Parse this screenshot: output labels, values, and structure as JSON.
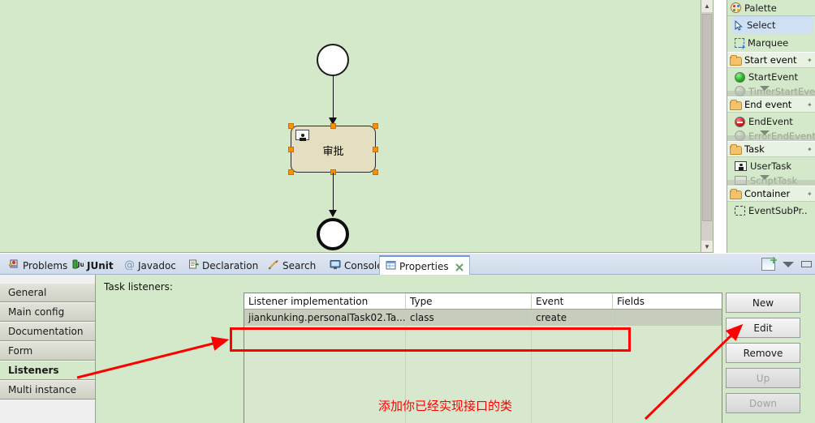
{
  "canvas": {
    "background_color": "#d4e8ca",
    "nodes": [
      {
        "name": "start-event",
        "label": "",
        "shape": "circle-thin"
      },
      {
        "name": "user-task",
        "label": "审批",
        "shape": "rounded-rect",
        "selected": true,
        "fill": "#e3dfc0"
      },
      {
        "name": "end-event",
        "label": "",
        "shape": "circle-thick"
      }
    ],
    "scrollbar": {
      "up_arrow": "^",
      "down_arrow": "v"
    }
  },
  "palette": {
    "title": "Palette",
    "title_icon": "palette-icon",
    "tools": [
      {
        "label": "Select",
        "icon": "cursor-icon",
        "selected": true
      },
      {
        "label": "Marquee",
        "icon": "marquee-icon",
        "selected": false
      }
    ],
    "groups": [
      {
        "label": "Start event",
        "items": [
          {
            "label": "StartEvent",
            "icon": "start-event-icon"
          }
        ],
        "clipped_item": {
          "label": "TimerStartEvent",
          "icon": "grey-disc-icon"
        }
      },
      {
        "label": "End event",
        "items": [
          {
            "label": "EndEvent",
            "icon": "end-event-icon"
          }
        ],
        "clipped_item": {
          "label": "ErrorEndEvent",
          "icon": "grey-disc-icon"
        }
      },
      {
        "label": "Task",
        "items": [
          {
            "label": "UserTask",
            "icon": "user-task-icon"
          }
        ],
        "clipped_item": {
          "label": "ScriptTask",
          "icon": "grey-rect-icon"
        }
      },
      {
        "label": "Container",
        "items": [
          {
            "label": "EventSubPr..",
            "icon": "event-subprocess-icon"
          }
        ],
        "clipped_item": null
      }
    ]
  },
  "view_tabs": {
    "tabs": [
      {
        "label": "Problems",
        "icon": "problems-icon",
        "active": false,
        "bold": false
      },
      {
        "label": "JUnit",
        "icon": "junit-icon",
        "active": false,
        "bold": true
      },
      {
        "label": "Javadoc",
        "icon": "javadoc-icon",
        "active": false,
        "bold": false
      },
      {
        "label": "Declaration",
        "icon": "declaration-icon",
        "active": false,
        "bold": false
      },
      {
        "label": "Search",
        "icon": "search-icon",
        "active": false,
        "bold": false
      },
      {
        "label": "Console",
        "icon": "console-icon",
        "active": false,
        "bold": false
      },
      {
        "label": "Properties",
        "icon": "properties-icon",
        "active": true,
        "bold": false,
        "closable": true
      }
    ],
    "toolbar": [
      {
        "name": "new-view-icon"
      },
      {
        "name": "view-menu-chevron-icon"
      },
      {
        "name": "minimize-icon"
      }
    ]
  },
  "properties": {
    "tabs": [
      {
        "label": "General",
        "active": false
      },
      {
        "label": "Main config",
        "active": false
      },
      {
        "label": "Documentation",
        "active": false
      },
      {
        "label": "Form",
        "active": false
      },
      {
        "label": "Listeners",
        "active": true
      },
      {
        "label": "Multi instance",
        "active": false
      }
    ],
    "section_label": "Task listeners:",
    "table": {
      "columns": [
        "Listener implementation",
        "Type",
        "Event",
        "Fields"
      ],
      "rows": [
        {
          "implementation": "jiankunking.personalTask02.Ta...",
          "type": "class",
          "event": "create",
          "fields": "",
          "selected": true
        }
      ],
      "empty_row_count": 6
    },
    "buttons": [
      {
        "label": "New",
        "enabled": true
      },
      {
        "label": "Edit",
        "enabled": true
      },
      {
        "label": "Remove",
        "enabled": true
      },
      {
        "label": "Up",
        "enabled": false
      },
      {
        "label": "Down",
        "enabled": false
      }
    ]
  },
  "annotations": {
    "note_text": "添加你已经实现接口的类",
    "note_color": "#ff0000",
    "highlight_box_color": "#ff0000",
    "arrows": 2
  }
}
